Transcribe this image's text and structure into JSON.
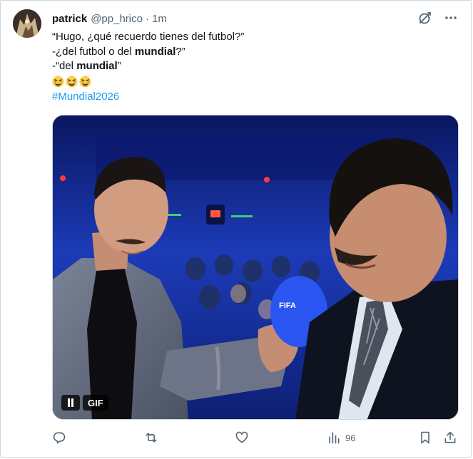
{
  "tweet": {
    "author_name": "patrick",
    "author_handle": "@pp_hrico",
    "separator": "·",
    "timestamp": "1m",
    "lines": [
      "“Hugo, ¿qué recuerdo tienes del futbol?”",
      "-¿del futbol o del ",
      "mundial",
      "?”",
      "-“del ",
      "mundial",
      "”"
    ],
    "emojis": [
      "grinning-squinting-face",
      "grinning-squinting-face",
      "grinning-squinting-face"
    ],
    "hashtag": "#Mundial2026"
  },
  "media": {
    "type": "GIF",
    "badge_label": "GIF",
    "control": "pause-icon",
    "mic_flag_text": "FIFA"
  },
  "actions": {
    "reply_icon": "reply-icon",
    "retweet_icon": "retweet-icon",
    "like_icon": "heart-icon",
    "views_count": "96",
    "bookmark_icon": "bookmark-icon",
    "share_icon": "share-icon"
  },
  "colors": {
    "link": "#1d9bf0",
    "secondary_text": "#536471",
    "border": "#cfd9de"
  }
}
